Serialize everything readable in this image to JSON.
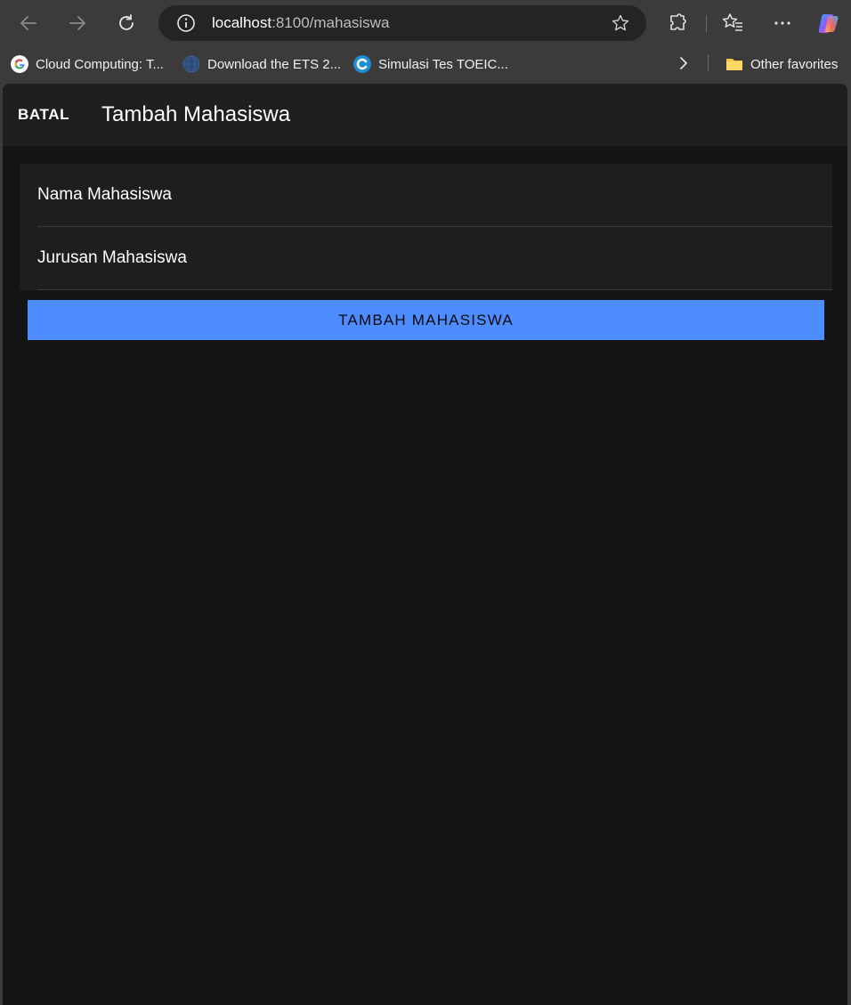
{
  "browser": {
    "url_host": "localhost",
    "url_path": ":8100/mahasiswa",
    "bookmarks": [
      {
        "label": "Cloud Computing: T..."
      },
      {
        "label": "Download the ETS 2..."
      },
      {
        "label": "Simulasi Tes TOEIC..."
      }
    ],
    "other_favorites": "Other favorites"
  },
  "app": {
    "header": {
      "cancel_label": "BATAL",
      "title": "Tambah Mahasiswa"
    },
    "form": {
      "name_placeholder": "Nama Mahasiswa",
      "name_value": "",
      "major_placeholder": "Jurusan Mahasiswa",
      "major_value": ""
    },
    "submit_label": "TAMBAH MAHASISWA",
    "colors": {
      "primary": "#4d8dff",
      "background": "#141414",
      "toolbar": "#1f1f1f"
    }
  }
}
